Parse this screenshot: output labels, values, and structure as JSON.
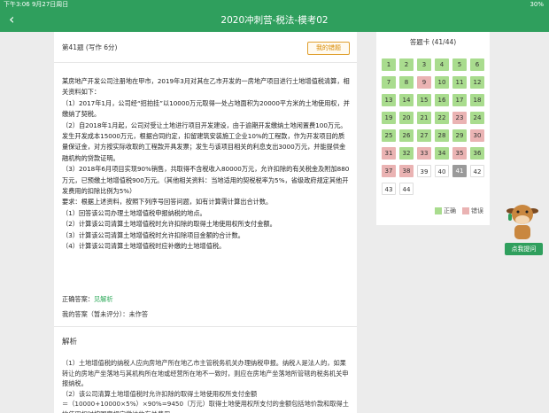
{
  "status": {
    "left": "下午3:06  9月27日周日",
    "right": "30%"
  },
  "nav": {
    "back_label": "‹",
    "title": "2020冲刺营-税法-模考02"
  },
  "question": {
    "header": "第41题 (写作 6分)",
    "wrong_button": "我的错题",
    "body": [
      "某房地产开发公司注册地在甲市，2019年3月对其在乙市开发的一房地产项目进行土地增值税清算，相关资料如下：",
      "（1）2017年1月，公司经“招拍挂”以10000万元取得一处占地面积为20000平方米的土地使用权，并缴纳了契税。",
      "（2）自2018年1月起，公司对受让土地进行项目开发建设，由于逾期开发缴纳土地闲置费100万元。发生开发成本15000万元，根据合同约定，扣留建筑安装施工企业10%的工程款，作为开发项目的质量保证金，对方按实际收取的工程款开具发票；发生与该项目相关的利息支出3000万元，并能提供金融机构的贷款证明。",
      "（3）2018年6月项目实现90%销售，共取得不含税收入80000万元，允许扣除的有关税金及附加880万元，已预缴土地增值税900万元。（其他相关资料：当地适用的契税税率为5%，省级政府规定其他开发费用的扣除比例为5%）",
      "要求：根据上述资料，按照下列序号回答问题，如有计算需计算出合计数。",
      "（1）回答该公司办理土地增值税申报纳税的地点。",
      "（2）计算该公司清算土地增值税时允许扣除的取得土地使用权所支付金额。",
      "（3）计算该公司清算土地增值税时允许扣除项目金额的合计数。",
      "（4）计算该公司清算土地增值税时应补缴的土地增值税。"
    ],
    "correct_answer_label": "正确答案：",
    "correct_answer_value": "见解析",
    "my_answer": "我的答案（暂未评分）：未作答"
  },
  "analysis": {
    "title": "解析",
    "lines": [
      "（1）土地增值税的纳税人应向房地产所在地乙市主管税务机关办理纳税申报。纳税人是法人的，如果转让的房地产坐落地与其机构所在地或经营所在地不一致时，则应在房地产坐落地所管辖的税务机关申报纳税。",
      "（2）该公司清算土地增值税时允许扣除的取得土地使用权所支付金额",
      "＝（10000+10000×5%）×90%=9450（万元）取得土地使用权所支付的金额包括地价款和取得土地使用权时按国家规定缴纳的有关费用。"
    ]
  },
  "answer_card": {
    "title": "答题卡 (41/44)",
    "items": [
      {
        "n": "1",
        "s": "correct"
      },
      {
        "n": "2",
        "s": "correct"
      },
      {
        "n": "3",
        "s": "correct"
      },
      {
        "n": "4",
        "s": "correct"
      },
      {
        "n": "5",
        "s": "correct"
      },
      {
        "n": "6",
        "s": "correct"
      },
      {
        "n": "7",
        "s": "correct"
      },
      {
        "n": "8",
        "s": "correct"
      },
      {
        "n": "9",
        "s": "wrong"
      },
      {
        "n": "10",
        "s": "correct"
      },
      {
        "n": "11",
        "s": "correct"
      },
      {
        "n": "12",
        "s": "correct"
      },
      {
        "n": "13",
        "s": "correct"
      },
      {
        "n": "14",
        "s": "correct"
      },
      {
        "n": "15",
        "s": "correct"
      },
      {
        "n": "16",
        "s": "correct"
      },
      {
        "n": "17",
        "s": "correct"
      },
      {
        "n": "18",
        "s": "correct"
      },
      {
        "n": "19",
        "s": "correct"
      },
      {
        "n": "20",
        "s": "correct"
      },
      {
        "n": "21",
        "s": "correct"
      },
      {
        "n": "22",
        "s": "correct"
      },
      {
        "n": "23",
        "s": "wrong"
      },
      {
        "n": "24",
        "s": "correct"
      },
      {
        "n": "25",
        "s": "correct"
      },
      {
        "n": "26",
        "s": "correct"
      },
      {
        "n": "27",
        "s": "correct"
      },
      {
        "n": "28",
        "s": "correct"
      },
      {
        "n": "29",
        "s": "correct"
      },
      {
        "n": "30",
        "s": "wrong"
      },
      {
        "n": "31",
        "s": "wrong"
      },
      {
        "n": "32",
        "s": "correct"
      },
      {
        "n": "33",
        "s": "wrong"
      },
      {
        "n": "34",
        "s": "correct"
      },
      {
        "n": "35",
        "s": "wrong"
      },
      {
        "n": "36",
        "s": "correct"
      },
      {
        "n": "37",
        "s": "wrong"
      },
      {
        "n": "38",
        "s": "wrong"
      },
      {
        "n": "39",
        "s": "empty"
      },
      {
        "n": "40",
        "s": "empty"
      },
      {
        "n": "41",
        "s": "current"
      },
      {
        "n": "42",
        "s": "empty"
      },
      {
        "n": "43",
        "s": "empty"
      },
      {
        "n": "44",
        "s": "empty"
      }
    ],
    "legend_correct": "正确",
    "legend_wrong": "错误"
  },
  "ask_button": "点我提问",
  "colors": {
    "brand": "#2f9f5d",
    "correct": "#a9dc8e",
    "wrong": "#eab3b3",
    "current": "#9a9a9a"
  }
}
